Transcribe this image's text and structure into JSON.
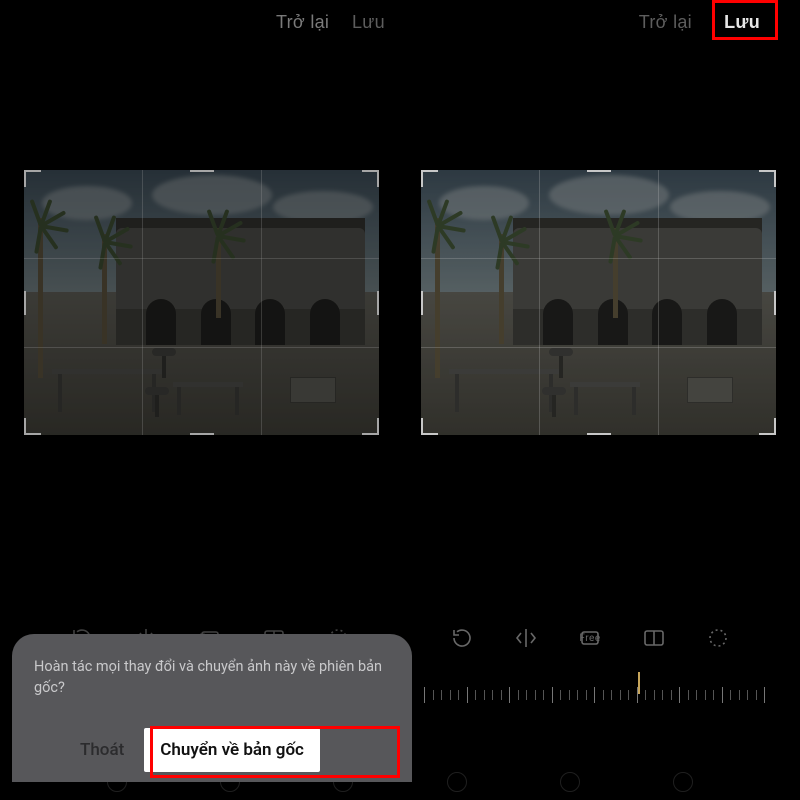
{
  "header": {
    "back": "Trở lại",
    "save": "Lưu"
  },
  "toolbar": {
    "rotate": "rotate",
    "flip": "flip",
    "free": "Free",
    "ratio": "ratio",
    "perspective": "perspective"
  },
  "dialog": {
    "message": "Hoàn tác mọi thay đổi và chuyển ảnh này về phiên bản gốc?",
    "exit": "Thoát",
    "revert": "Chuyển về bản gốc"
  },
  "highlight_color": "#ff0000"
}
